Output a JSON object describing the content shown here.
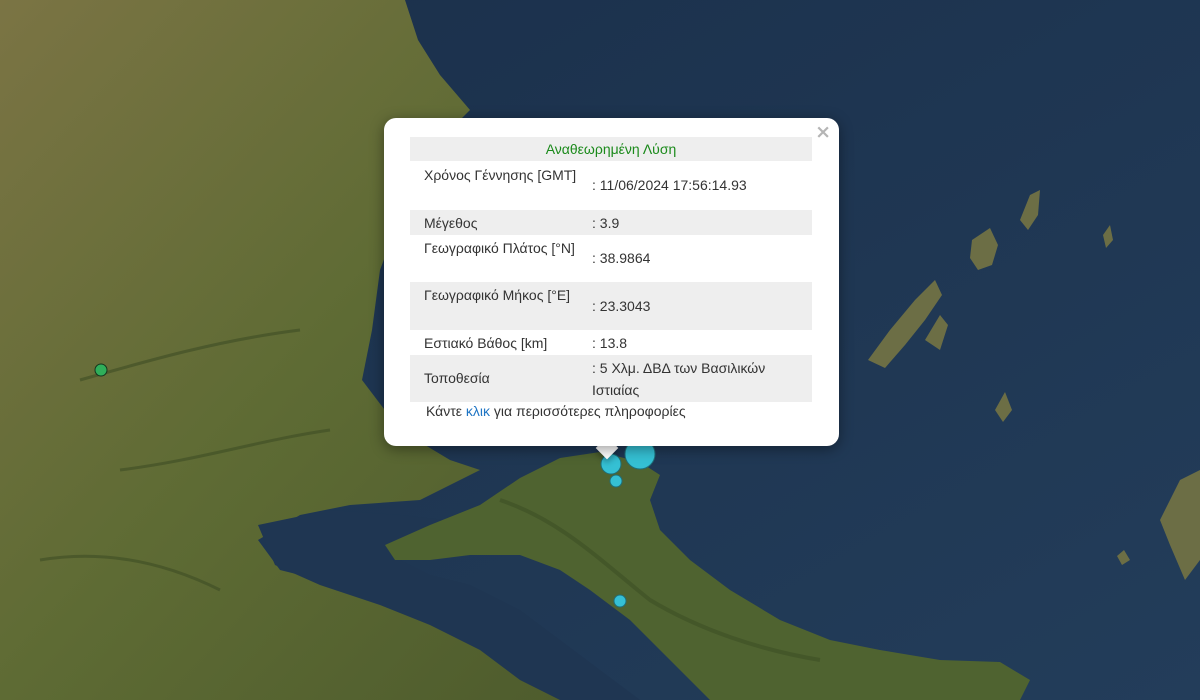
{
  "popup": {
    "close_symbol": "×",
    "title": "Αναθεωρημένη Λύση",
    "rows": [
      {
        "label": "Χρόνος Γέννησης [GMT]",
        "value": ": 11/06/2024 17:56:14.93"
      },
      {
        "label": "Μέγεθος",
        "value": ": 3.9"
      },
      {
        "label": "Γεωγραφικό Πλάτος [°N]",
        "value": ": 38.9864"
      },
      {
        "label": "Γεωγραφικό Μήκος [°E]",
        "value": ": 23.3043"
      },
      {
        "label": "Εστιακό Βάθος [km]",
        "value": ": 13.8"
      },
      {
        "label": "Τοποθεσία",
        "value": ": 5 Χλμ. ΔΒΔ των Βασιλικών Ιστιαίας"
      }
    ],
    "footer": {
      "prefix": "Κάντε ",
      "link": "κλικ",
      "suffix": " για περισσότερες πληροφορίες"
    }
  },
  "colors": {
    "sea": "#1f3652",
    "land": "#6b6a3c",
    "marker_recent": "#35c0d4",
    "marker_old": "#2fae5a",
    "title_text": "#1b8a1b",
    "link": "#1f75c4"
  }
}
